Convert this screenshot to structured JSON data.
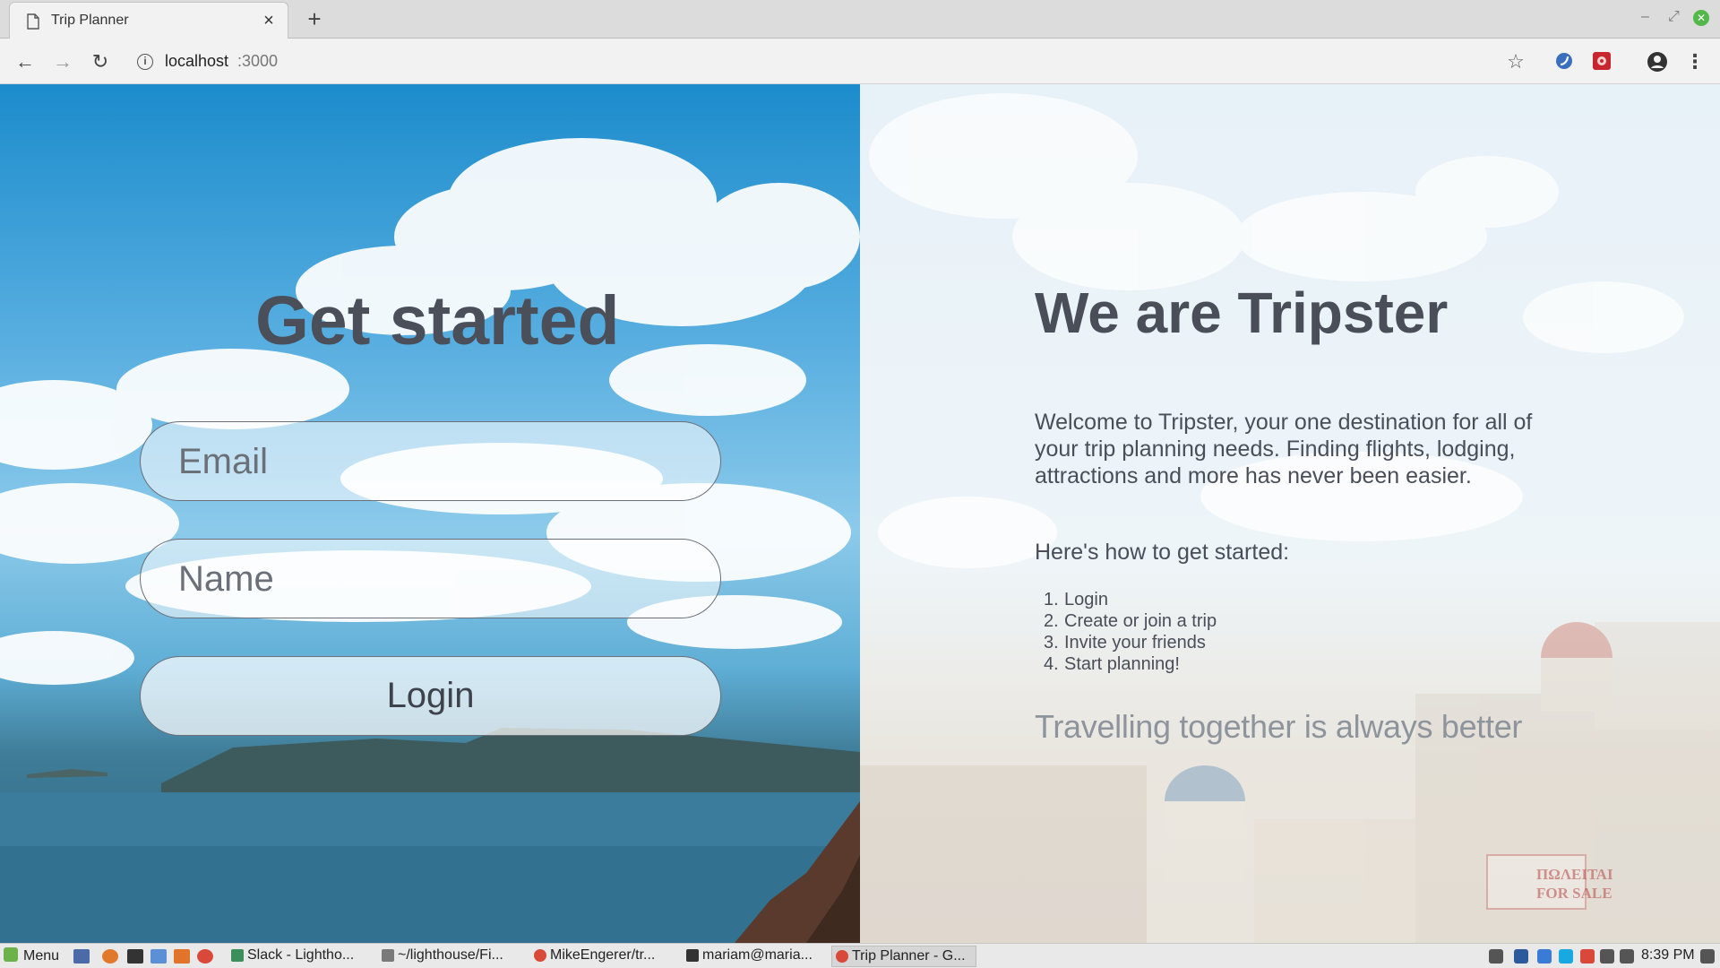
{
  "browser": {
    "tab_title": "Trip Planner",
    "tab_close_glyph": "×",
    "new_tab_glyph": "+",
    "url_host": "localhost",
    "url_port": ":3000"
  },
  "login": {
    "heading": "Get started",
    "email_placeholder": "Email",
    "name_placeholder": "Name",
    "login_label": "Login"
  },
  "about": {
    "title": "We are Tripster",
    "intro": "Welcome to Tripster, your one destination for all of your trip planning needs. Finding flights, lodging, attractions and more has never been easier.",
    "howto": "Here's how to get started:",
    "steps": [
      {
        "num": "1.",
        "text": "Login"
      },
      {
        "num": "2.",
        "text": "Create or join a trip"
      },
      {
        "num": "3.",
        "text": "Invite your friends"
      },
      {
        "num": "4.",
        "text": "Start planning!"
      }
    ],
    "tagline": "Travelling together is always better",
    "sign_text": "ΠΩΛΕΙΤΑΙ FOR SALE"
  },
  "taskbar": {
    "menu_label": "Menu",
    "tasks": [
      {
        "label": "Slack - Lightho...",
        "icon": "slack-icon",
        "color": "#3c8f5a"
      },
      {
        "label": "~/lighthouse/Fi...",
        "icon": "folder-icon",
        "color": "#7a7a7a"
      },
      {
        "label": "MikeEngerer/tr...",
        "icon": "chrome-icon",
        "color": "#d9493a"
      },
      {
        "label": "mariam@maria...",
        "icon": "terminal-icon",
        "color": "#333333"
      },
      {
        "label": "Trip Planner - G...",
        "icon": "chrome-icon",
        "color": "#d9493a"
      }
    ],
    "clock": "8:39 PM"
  },
  "colors": {
    "heading": "#4a4f5a",
    "tagline": "#8e949c",
    "sky": "#1c8ccc"
  }
}
